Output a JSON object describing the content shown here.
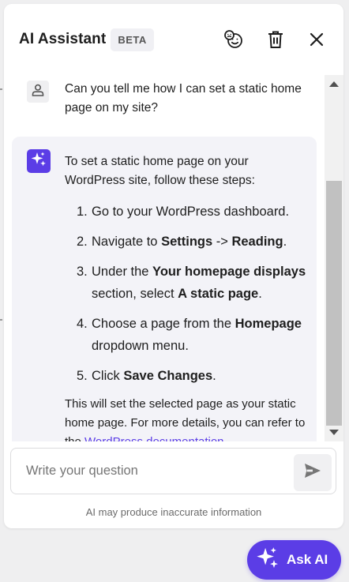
{
  "header": {
    "title": "AI Assistant",
    "badge": "BETA"
  },
  "chat": {
    "user_message": "Can you tell me how I can set a static home page on my site?",
    "ai_intro": "To set a static home page on your WordPress site, follow these steps:",
    "steps": [
      {
        "num": "1.",
        "text": "Go to your WordPress dashboard."
      },
      {
        "num": "2.",
        "pre": "Navigate to ",
        "b1": "Settings",
        "mid": " -> ",
        "b2": "Reading",
        "post": "."
      },
      {
        "num": "3.",
        "pre": "Under the ",
        "b1": "Your homepage displays",
        "mid": " section, select ",
        "b2": "A static page",
        "post": "."
      },
      {
        "num": "4.",
        "pre": "Choose a page from the ",
        "b1": "Homepage",
        "post": " dropdown menu."
      },
      {
        "num": "5.",
        "pre": "Click ",
        "b1": "Save Changes",
        "post": "."
      }
    ],
    "outro_pre": "This will set the selected page as your static home page. For more details, you can refer to the ",
    "outro_link": "WordPress documentation",
    "outro_post": "."
  },
  "input": {
    "placeholder": "Write your question",
    "value": ""
  },
  "disclaimer": "AI may produce inaccurate information",
  "fab": {
    "label": "Ask AI"
  },
  "icons": {
    "emoji": "emoji-icon",
    "trash": "trash-icon",
    "close": "close-icon",
    "user": "user-icon",
    "sparkle": "sparkle-icon",
    "send": "send-icon"
  },
  "colors": {
    "accent": "#5b3de6",
    "ai_bubble": "#f3f3f8",
    "text": "#1e1e1e"
  }
}
